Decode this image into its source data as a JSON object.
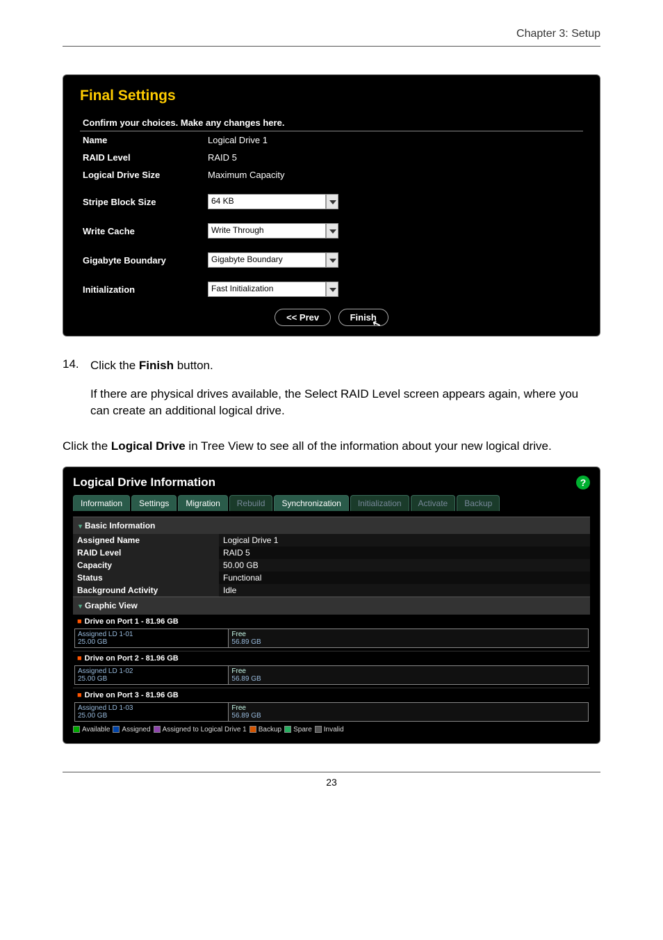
{
  "header": {
    "chapter": "Chapter 3: Setup"
  },
  "final_settings": {
    "title": "Final Settings",
    "subtitle": "Confirm your choices. Make any changes here.",
    "rows": {
      "name_label": "Name",
      "name_value": "Logical Drive 1",
      "raid_label": "RAID Level",
      "raid_value": "RAID 5",
      "lds_label": "Logical Drive Size",
      "lds_value": "Maximum Capacity",
      "sbs_label": "Stripe Block Size",
      "sbs_value": "64 KB",
      "wc_label": "Write Cache",
      "wc_value": "Write Through",
      "gb_label": "Gigabyte Boundary",
      "gb_value": "Gigabyte Boundary",
      "init_label": "Initialization",
      "init_value": "Fast Initialization"
    },
    "buttons": {
      "prev": "<< Prev",
      "finish": "Finish"
    }
  },
  "step": {
    "num": "14.",
    "line1a": "Click the ",
    "line1b": "Finish",
    "line1c": " button.",
    "line2": "If there are physical drives available, the Select RAID Level screen appears again, where you can create an additional logical drive."
  },
  "note": {
    "a": "Click the ",
    "b": "Logical Drive",
    "c": " in Tree View to see all of the information about your new logical drive."
  },
  "ldi": {
    "title": "Logical Drive Information",
    "tabs": {
      "information": "Information",
      "settings": "Settings",
      "migration": "Migration",
      "rebuild": "Rebuild",
      "synchronization": "Synchronization",
      "initialization": "Initialization",
      "activate": "Activate",
      "backup": "Backup"
    },
    "basic_hdr": "Basic Information",
    "basic": {
      "assigned_name_l": "Assigned Name",
      "assigned_name_v": "Logical Drive 1",
      "raid_l": "RAID Level",
      "raid_v": "RAID 5",
      "cap_l": "Capacity",
      "cap_v": "50.00 GB",
      "status_l": "Status",
      "status_v": "Functional",
      "bg_l": "Background Activity",
      "bg_v": "Idle"
    },
    "graphic_hdr": "Graphic View",
    "drives": [
      {
        "hdr": "Drive on Port 1 - 81.96 GB",
        "assigned": "Assigned LD 1-01",
        "assigned_size": "25.00 GB",
        "free": "Free",
        "free_size": "56.89 GB"
      },
      {
        "hdr": "Drive on Port 2 - 81.96 GB",
        "assigned": "Assigned LD 1-02",
        "assigned_size": "25.00 GB",
        "free": "Free",
        "free_size": "56.89 GB"
      },
      {
        "hdr": "Drive on Port 3 - 81.96 GB",
        "assigned": "Assigned LD 1-03",
        "assigned_size": "25.00 GB",
        "free": "Free",
        "free_size": "56.89 GB"
      }
    ],
    "legend": {
      "available": "Available",
      "assigned": "Assigned",
      "ald1": "Assigned to Logical Drive 1",
      "backup": "Backup",
      "spare": "Spare",
      "invalid": "Invalid"
    }
  },
  "footer": {
    "page": "23"
  }
}
